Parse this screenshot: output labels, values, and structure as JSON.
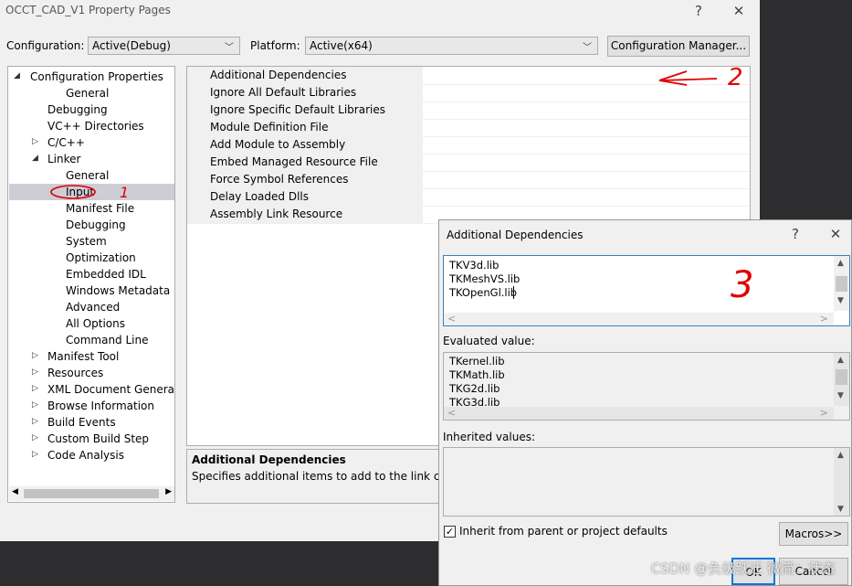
{
  "window": {
    "title": "OCCT_CAD_V1 Property Pages",
    "help_glyph": "?",
    "close_glyph": "✕"
  },
  "config": {
    "configuration_label": "Configuration:",
    "configuration_value": "Active(Debug)",
    "platform_label": "Platform:",
    "platform_value": "Active(x64)",
    "manager_button": "Configuration Manager..."
  },
  "tree": {
    "items": [
      {
        "label": "Configuration Properties",
        "toggle": "◢"
      },
      {
        "label": "General",
        "toggle": ""
      },
      {
        "label": "Debugging",
        "toggle": ""
      },
      {
        "label": "VC++ Directories",
        "toggle": ""
      },
      {
        "label": "C/C++",
        "toggle": "▷"
      },
      {
        "label": "Linker",
        "toggle": "◢"
      },
      {
        "label": "General",
        "toggle": ""
      },
      {
        "label": "Input",
        "toggle": ""
      },
      {
        "label": "Manifest File",
        "toggle": ""
      },
      {
        "label": "Debugging",
        "toggle": ""
      },
      {
        "label": "System",
        "toggle": ""
      },
      {
        "label": "Optimization",
        "toggle": ""
      },
      {
        "label": "Embedded IDL",
        "toggle": ""
      },
      {
        "label": "Windows Metadata",
        "toggle": ""
      },
      {
        "label": "Advanced",
        "toggle": ""
      },
      {
        "label": "All Options",
        "toggle": ""
      },
      {
        "label": "Command Line",
        "toggle": ""
      },
      {
        "label": "Manifest Tool",
        "toggle": "▷"
      },
      {
        "label": "Resources",
        "toggle": "▷"
      },
      {
        "label": "XML Document Generator",
        "toggle": "▷"
      },
      {
        "label": "Browse Information",
        "toggle": "▷"
      },
      {
        "label": "Build Events",
        "toggle": "▷"
      },
      {
        "label": "Custom Build Step",
        "toggle": "▷"
      },
      {
        "label": "Code Analysis",
        "toggle": "▷"
      }
    ],
    "scroll_left": "◀",
    "scroll_right": "▶"
  },
  "properties": [
    "Additional Dependencies",
    "Ignore All Default Libraries",
    "Ignore Specific Default Libraries",
    "Module Definition File",
    "Add Module to Assembly",
    "Embed Managed Resource File",
    "Force Symbol References",
    "Delay Loaded Dlls",
    "Assembly Link Resource"
  ],
  "description": {
    "title": "Additional Dependencies",
    "text": "Specifies additional items to add to the link comma"
  },
  "dialog": {
    "title": "Additional Dependencies",
    "help_glyph": "?",
    "close_glyph": "✕",
    "edit_lines": [
      "TKV3d.lib",
      "TKMeshVS.lib",
      "TKOpenGl.lib"
    ],
    "evaluated_label": "Evaluated value:",
    "evaluated_lines": [
      "TKernel.lib",
      "TKMath.lib",
      "TKG2d.lib",
      "TKG3d.lib"
    ],
    "inherited_label": "Inherited values:",
    "inherit_checkbox_label": "Inherit from parent or project defaults",
    "inherit_checked": true,
    "macros_button": "Macros>>",
    "ok_button": "OK",
    "cancel_button": "Cancel",
    "scroll_up": "▲",
    "scroll_down": "▼",
    "scroll_left": "<",
    "scroll_right": ">"
  },
  "annotations": {
    "mark_1": "1",
    "mark_2": "2",
    "mark_3": "3",
    "color": "#e00000"
  },
  "watermark": "CSDN @负级跃迁 微简：状态"
}
